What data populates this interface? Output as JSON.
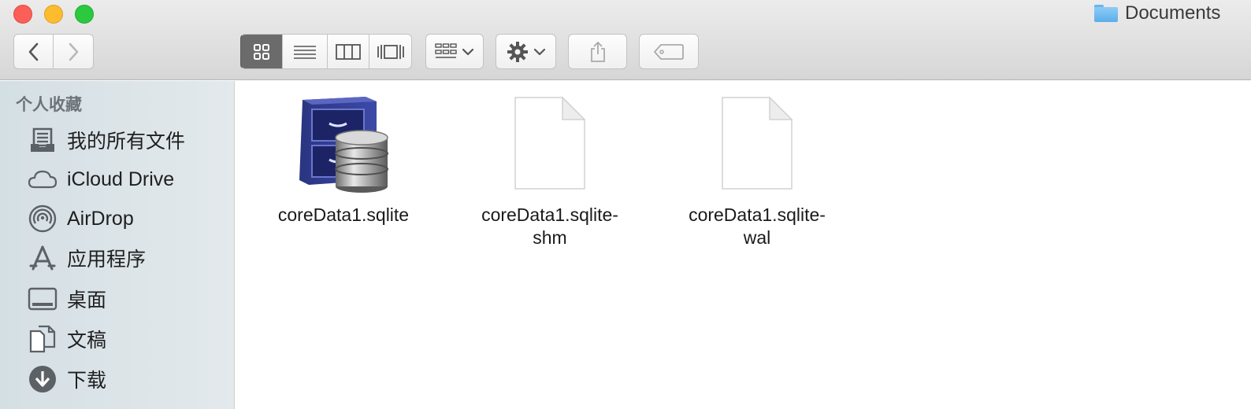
{
  "window": {
    "title": "Documents",
    "title_icon": "folder-icon"
  },
  "toolbar": {
    "back_icon": "chevron-left-icon",
    "forward_icon": "chevron-right-icon",
    "views": [
      "icon-view-icon",
      "list-view-icon",
      "column-view-icon",
      "cover-flow-icon"
    ],
    "arrange_icon": "arrange-grid-icon",
    "action_icon": "gear-icon",
    "share_icon": "share-icon",
    "tags_icon": "tag-icon"
  },
  "sidebar": {
    "heading": "个人收藏",
    "items": [
      {
        "label": "我的所有文件",
        "icon": "all-files-icon"
      },
      {
        "label": "iCloud Drive",
        "icon": "cloud-icon"
      },
      {
        "label": "AirDrop",
        "icon": "airdrop-icon"
      },
      {
        "label": "应用程序",
        "icon": "applications-icon"
      },
      {
        "label": "桌面",
        "icon": "desktop-icon"
      },
      {
        "label": "文稿",
        "icon": "documents-icon"
      },
      {
        "label": "下载",
        "icon": "download-icon"
      }
    ]
  },
  "files": [
    {
      "name_line1": "coreData1.sqlite",
      "name_line2": "",
      "icon": "sqlite-database-icon"
    },
    {
      "name_line1": "coreData1.sqlite-",
      "name_line2": "shm",
      "icon": "blank-document-icon"
    },
    {
      "name_line1": "coreData1.sqlite-",
      "name_line2": "wal",
      "icon": "blank-document-icon"
    }
  ],
  "colors": {
    "close": "#fc5f57",
    "minimize": "#fdbc2e",
    "maximize": "#2ac940",
    "selected_view": "#6b6b6b",
    "folder_blue": "#5aaee9"
  }
}
